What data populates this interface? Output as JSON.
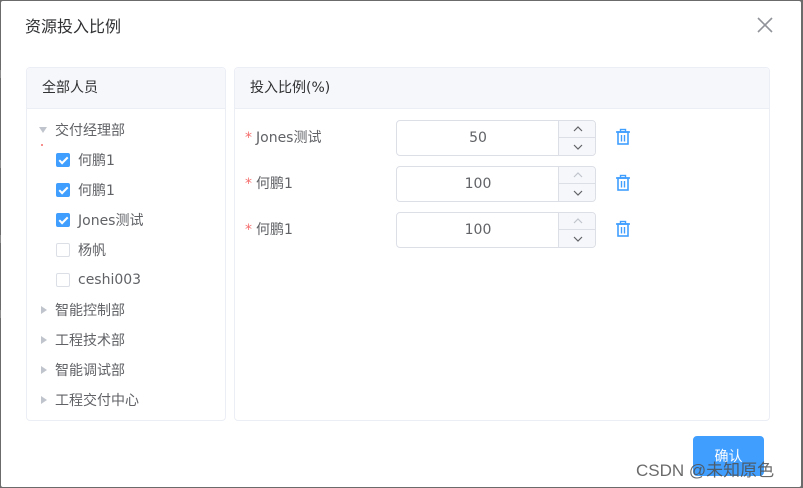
{
  "dialog": {
    "title": "资源投入比例"
  },
  "left_panel": {
    "header": "全部人员",
    "tree": [
      {
        "label": "交付经理部",
        "type": "group",
        "expanded": true
      },
      {
        "label": "何鹏1",
        "type": "member",
        "checked": true
      },
      {
        "label": "何鹏1",
        "type": "member",
        "checked": true
      },
      {
        "label": "Jones测试",
        "type": "member",
        "checked": true
      },
      {
        "label": "杨帆",
        "type": "member",
        "checked": false
      },
      {
        "label": "ceshi003",
        "type": "member",
        "checked": false
      },
      {
        "label": "智能控制部",
        "type": "group",
        "expanded": false
      },
      {
        "label": "工程技术部",
        "type": "group",
        "expanded": false
      },
      {
        "label": "智能调试部",
        "type": "group",
        "expanded": false
      },
      {
        "label": "工程交付中心",
        "type": "group",
        "expanded": false
      }
    ]
  },
  "right_panel": {
    "header": "投入比例(%)",
    "required_mark": "*",
    "rows": [
      {
        "label": "Jones测试",
        "value": "50"
      },
      {
        "label": "何鹏1",
        "value": "100"
      },
      {
        "label": "何鹏1",
        "value": "100"
      }
    ]
  },
  "footer": {
    "confirm_label": "确认"
  },
  "watermark": "CSDN @未知原色",
  "colors": {
    "primary": "#409eff",
    "required": "#f56c6c",
    "panel_header_bg": "#f5f7fa",
    "border": "#dcdfe6"
  },
  "icons": {
    "close": "close-icon",
    "expand": "caret-down-icon",
    "collapse": "caret-right-icon",
    "increase": "chevron-up-icon",
    "decrease": "chevron-down-icon",
    "delete": "trash-icon"
  }
}
